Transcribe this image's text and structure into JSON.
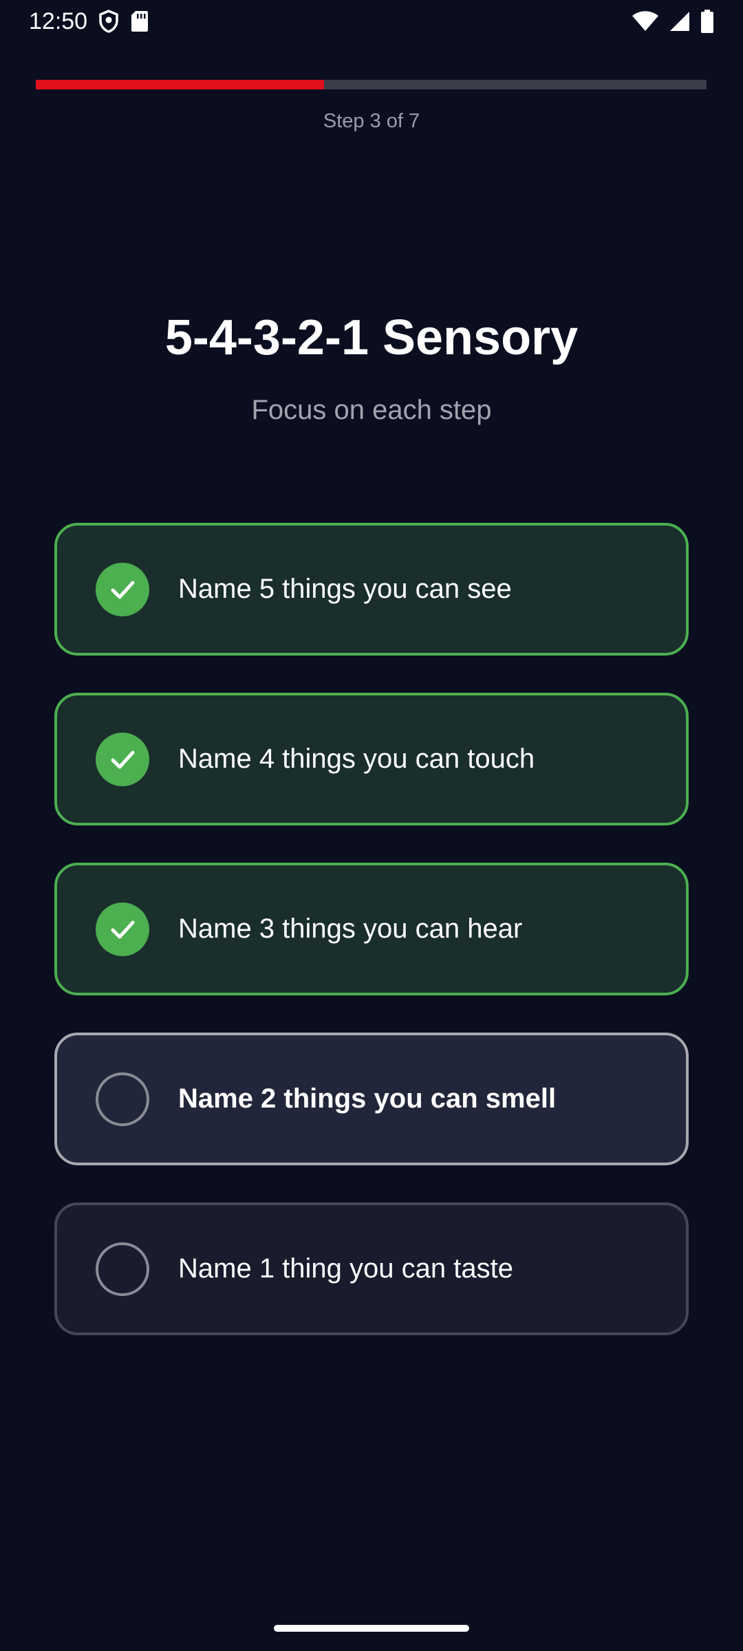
{
  "status_bar": {
    "time": "12:50"
  },
  "progress": {
    "fraction": 0.43,
    "label": "Step 3 of 7",
    "fill_color": "#e0101c"
  },
  "header": {
    "title": "5-4-3-2-1 Sensory",
    "subtitle": "Focus on each step"
  },
  "steps": [
    {
      "label": "Name 5 things you can see",
      "state": "done"
    },
    {
      "label": "Name 4 things you can touch",
      "state": "done"
    },
    {
      "label": "Name 3 things you can hear",
      "state": "done"
    },
    {
      "label": "Name 2 things you can smell",
      "state": "current"
    },
    {
      "label": "Name 1 thing you can taste",
      "state": "pending"
    }
  ],
  "colors": {
    "background": "#0a0e1f",
    "done_border": "#4caf50",
    "done_background": "#1a2e2c"
  }
}
